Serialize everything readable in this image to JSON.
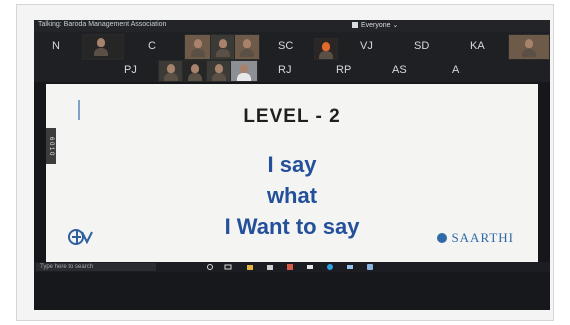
{
  "zoom": {
    "speaking_label": "Talking: Baroda Management Association",
    "view_menu": "Everyone",
    "participants_row1": [
      "N",
      "C",
      "SC",
      "VJ",
      "SD",
      "KA"
    ],
    "participants_row2": [
      "PJ",
      "RJ",
      "RP",
      "AS",
      "A"
    ]
  },
  "slide": {
    "level": "LEVEL - 2",
    "line1": "I say",
    "line2": "what",
    "line3": "I Want to say",
    "side_tab": "6 0 1 0",
    "brand_right": "SAARTHI",
    "colors": {
      "headline": "#24509b",
      "level_text": "#1f1f1f",
      "background": "#f4f4f2"
    }
  },
  "taskbar": {
    "search_placeholder": "Type here to search",
    "icons": [
      "search-icon",
      "task-view-icon",
      "file-explorer-icon",
      "store-icon",
      "calendar-icon",
      "mail-icon",
      "edge-icon",
      "photos-icon",
      "zoom-icon"
    ]
  }
}
